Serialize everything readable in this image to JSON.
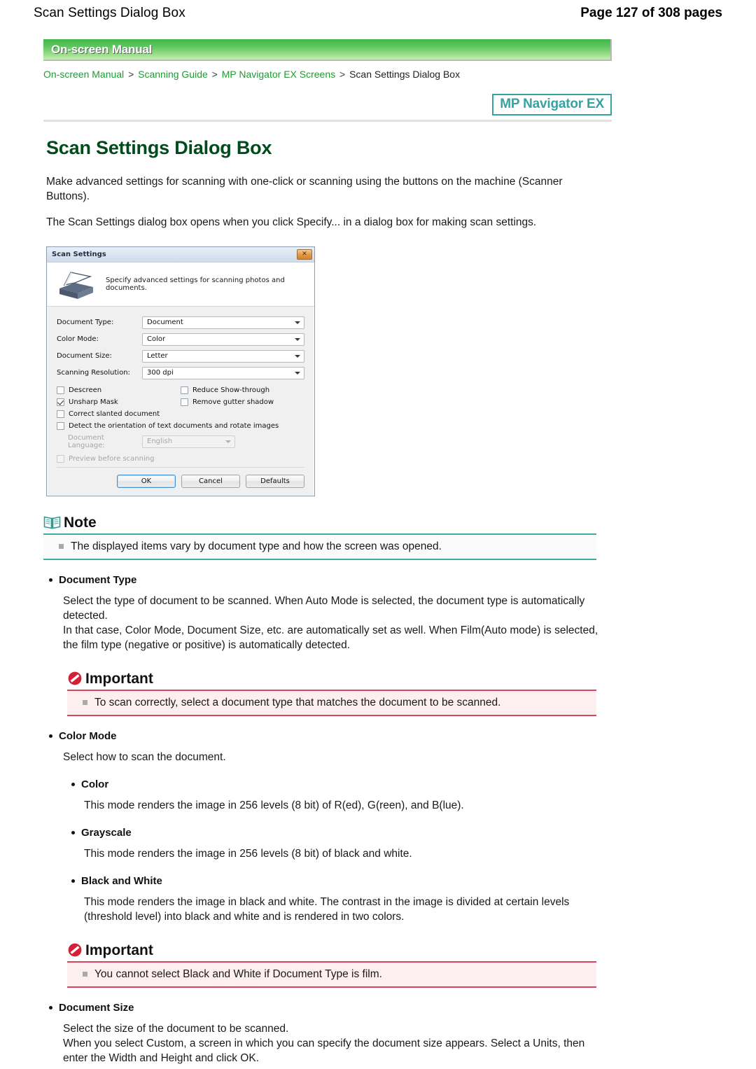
{
  "header": {
    "doc_title": "Scan Settings Dialog Box",
    "page_count": "Page 127 of 308 pages"
  },
  "banner": {
    "label": "On-screen Manual"
  },
  "breadcrumb": {
    "items": [
      {
        "label": "On-screen Manual",
        "current": false
      },
      {
        "label": "Scanning Guide",
        "current": false
      },
      {
        "label": "MP Navigator EX Screens",
        "current": false
      },
      {
        "label": "Scan Settings Dialog Box",
        "current": true
      }
    ],
    "separator": ">"
  },
  "badge": {
    "label": "MP Navigator EX"
  },
  "page": {
    "title": "Scan Settings Dialog Box",
    "intro_1": "Make advanced settings for scanning with one-click or scanning using the buttons on the machine (Scanner Buttons).",
    "intro_2": "The Scan Settings dialog box opens when you click Specify... in a dialog box for making scan settings."
  },
  "dialog": {
    "title": "Scan Settings",
    "close_label": "✕",
    "description": "Specify advanced settings for scanning photos and documents.",
    "fields": [
      {
        "label": "Document Type:",
        "value": "Document"
      },
      {
        "label": "Color Mode:",
        "value": "Color"
      },
      {
        "label": "Document Size:",
        "value": "Letter"
      },
      {
        "label": "Scanning Resolution:",
        "value": "300 dpi"
      }
    ],
    "checks_left": [
      {
        "label": "Descreen",
        "checked": false,
        "disabled": false
      },
      {
        "label": "Unsharp Mask",
        "checked": true,
        "disabled": false
      },
      {
        "label": "Correct slanted document",
        "checked": false,
        "disabled": false
      }
    ],
    "checks_right": [
      {
        "label": "Reduce Show-through",
        "checked": false,
        "disabled": false
      },
      {
        "label": "Remove gutter shadow",
        "checked": false,
        "disabled": false
      }
    ],
    "detect_orientation": {
      "label": "Detect the orientation of text documents and rotate images",
      "checked": false
    },
    "document_language": {
      "label": "Document Language:",
      "value": "English"
    },
    "preview_before_scanning": {
      "label": "Preview before scanning",
      "checked": false,
      "disabled": true
    },
    "buttons": [
      {
        "label": "OK",
        "default": true
      },
      {
        "label": "Cancel",
        "default": false
      },
      {
        "label": "Defaults",
        "default": false
      }
    ]
  },
  "note": {
    "title": "Note",
    "items": [
      "The displayed items vary by document type and how the screen was opened."
    ]
  },
  "sections": [
    {
      "heading": "Document Type",
      "paragraphs": [
        "Select the type of document to be scanned. When Auto Mode is selected, the document type is automatically detected.",
        "In that case, Color Mode, Document Size, etc. are automatically set as well. When Film(Auto mode) is selected, the film type (negative or positive) is automatically detected."
      ]
    }
  ],
  "important_1": {
    "title": "Important",
    "items": [
      "To scan correctly, select a document type that matches the document to be scanned."
    ]
  },
  "color_mode": {
    "heading": "Color Mode",
    "intro": "Select how to scan the document.",
    "modes": [
      {
        "heading": "Color",
        "text": "This mode renders the image in 256 levels (8 bit) of R(ed), G(reen), and B(lue)."
      },
      {
        "heading": "Grayscale",
        "text": "This mode renders the image in 256 levels (8 bit) of black and white."
      },
      {
        "heading": "Black and White",
        "text": "This mode renders the image in black and white. The contrast in the image is divided at certain levels (threshold level) into black and white and is rendered in two colors."
      }
    ]
  },
  "important_2": {
    "title": "Important",
    "items": [
      "You cannot select Black and White if Document Type is film."
    ]
  },
  "document_size": {
    "heading": "Document Size",
    "paragraphs": [
      "Select the size of the document to be scanned.",
      "When you select Custom, a screen in which you can specify the document size appears. Select a Units, then enter the Width and Height and click OK."
    ]
  },
  "icons": {
    "note": "book-icon",
    "important": "prohibition-icon",
    "scanner": "scanner-icon",
    "close": "close-icon",
    "caret": "chevron-down-icon"
  },
  "colors": {
    "title_green": "#004b1c",
    "link_green": "#1f9b34",
    "badge_teal": "#36a3a3",
    "note_rule": "#3fa9a4",
    "important_rule": "#d9455a",
    "important_bg": "#fdeef0"
  }
}
